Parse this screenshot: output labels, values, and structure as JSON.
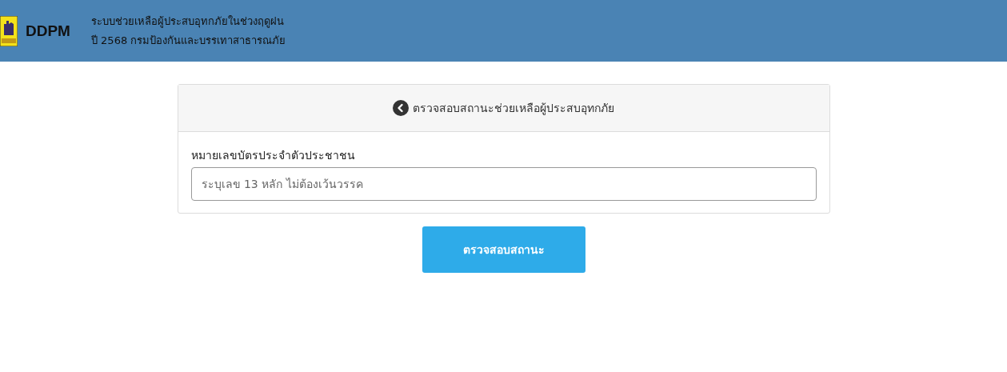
{
  "header": {
    "brand": "DDPM",
    "title_lines": [
      "ระบบช่วยเหลือผู้ประสบอุทกภัยในช่วงฤดูฝน",
      "ปี 2568 กรมป้องกันและบรรเทาสาธารณภัย"
    ]
  },
  "card": {
    "title": "ตรวจสอบสถานะช่วยเหลือผู้ประสบอุทกภัย",
    "field_label": "หมายเลขบัตรประจำตัวประชาชน",
    "field": {
      "placeholder": "ระบุเลข 13 หลัก ไม่ต้องเว้นวรรค"
    }
  },
  "submit_button": "ตรวจสอบสถานะ"
}
